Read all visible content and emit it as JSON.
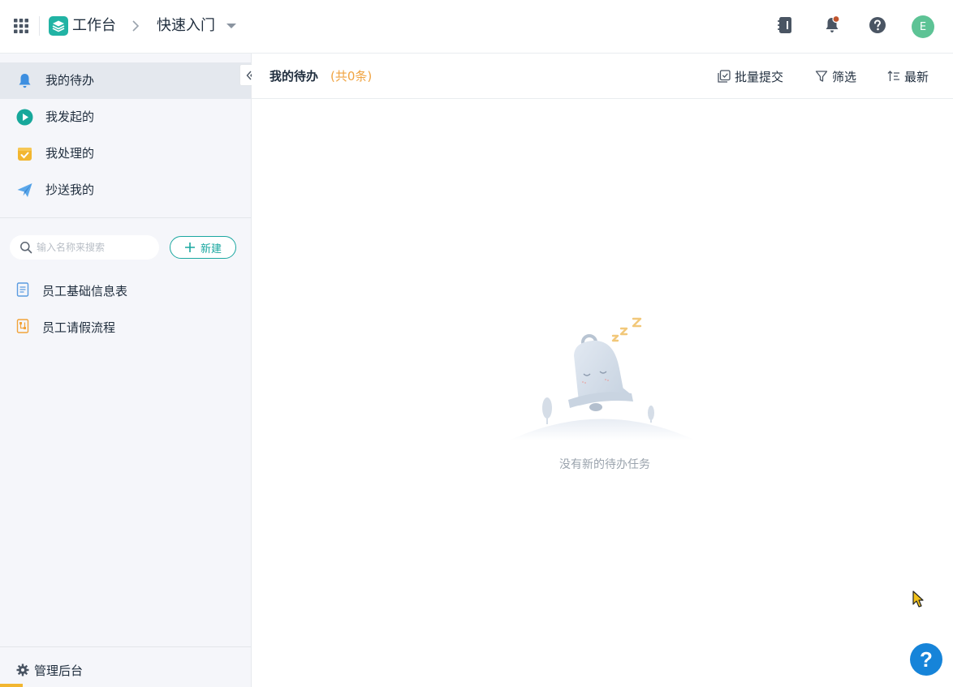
{
  "header": {
    "brand_title": "工作台",
    "breadcrumb_current": "快速入门",
    "avatar_initial": "E"
  },
  "sidebar": {
    "nav": [
      {
        "label": "我的待办",
        "icon": "bell-icon",
        "active": true
      },
      {
        "label": "我发起的",
        "icon": "play-icon",
        "active": false
      },
      {
        "label": "我处理的",
        "icon": "inbox-check-icon",
        "active": false
      },
      {
        "label": "抄送我的",
        "icon": "paper-plane-icon",
        "active": false
      }
    ],
    "search_placeholder": "输入名称来搜索",
    "new_button_label": "新建",
    "forms": [
      {
        "label": "员工基础信息表",
        "icon": "form-document-icon"
      },
      {
        "label": "员工请假流程",
        "icon": "workflow-icon"
      }
    ],
    "admin_label": "管理后台"
  },
  "main": {
    "title": "我的待办",
    "count_text": "(共0条)",
    "toolbar": {
      "batch_submit": "批量提交",
      "filter": "筛选",
      "sort": "最新"
    },
    "empty_text": "没有新的待办任务"
  },
  "help_fab_label": "?",
  "colors": {
    "accent_teal": "#1aa7a0",
    "count_orange": "#f0a340",
    "help_blue": "#1684d9",
    "avatar_green": "#5dc395"
  }
}
